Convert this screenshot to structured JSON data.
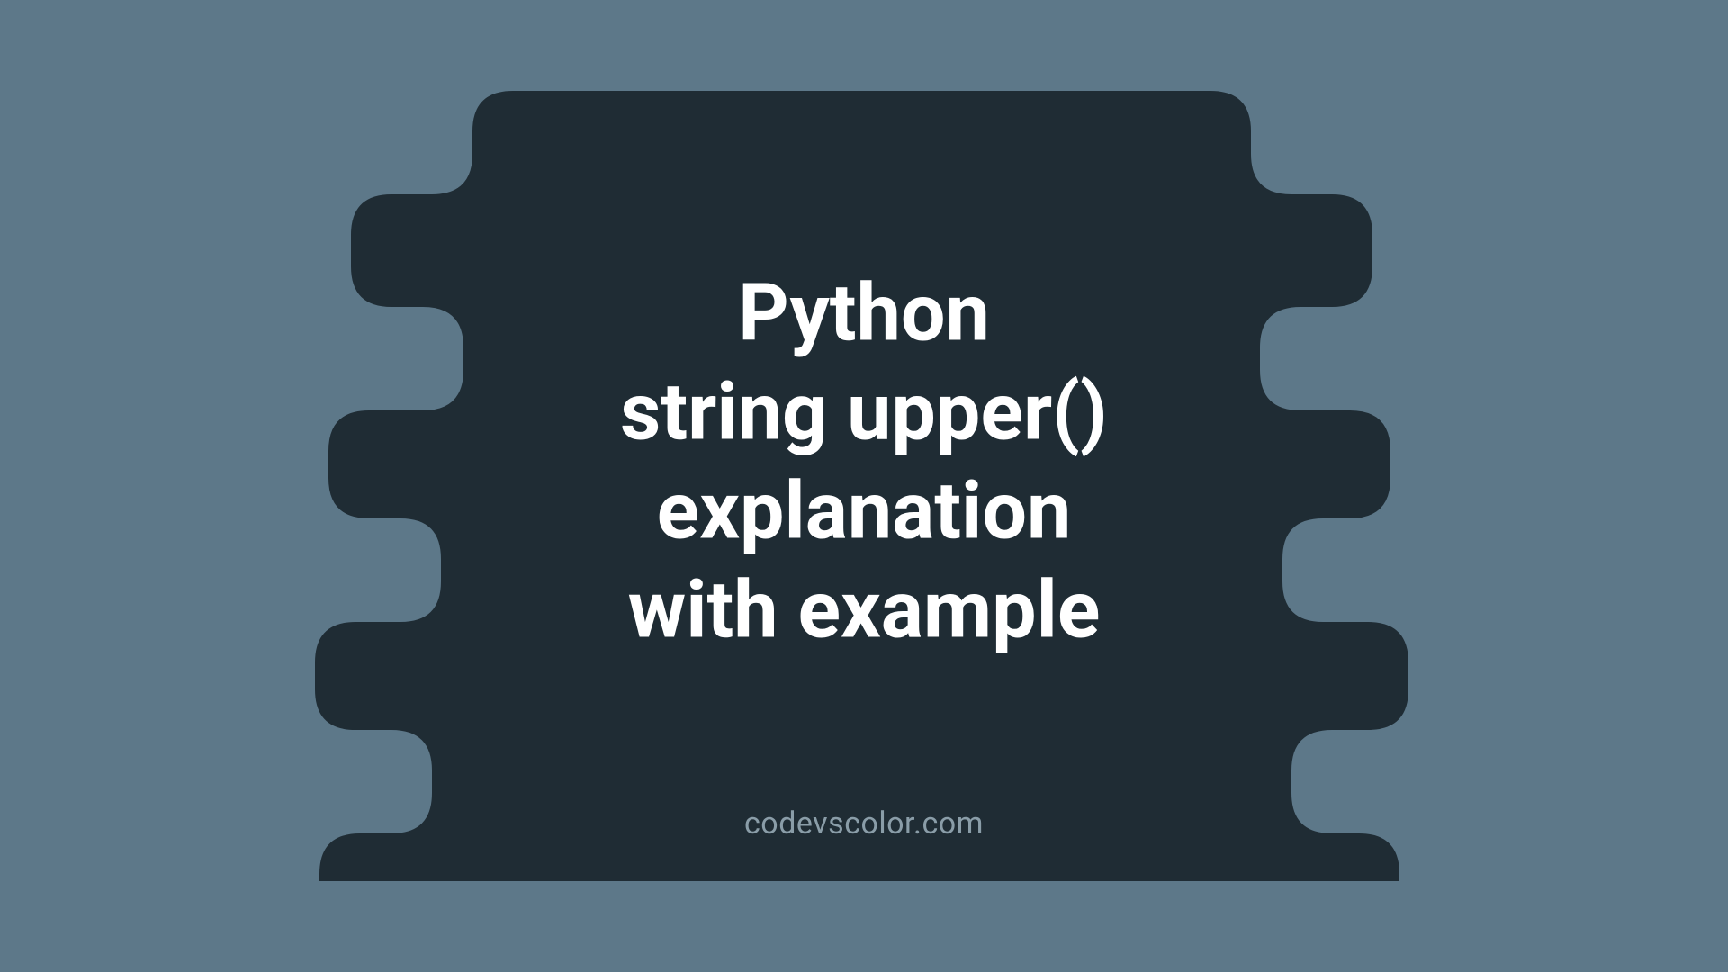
{
  "title": {
    "line1": "Python",
    "line2": "string upper()",
    "line3": "explanation",
    "line4": "with example"
  },
  "watermark": "codevscolor.com",
  "colors": {
    "background": "#5d7889",
    "shape": "#1f2c34",
    "text": "#ffffff",
    "watermark": "#8a9da8"
  }
}
